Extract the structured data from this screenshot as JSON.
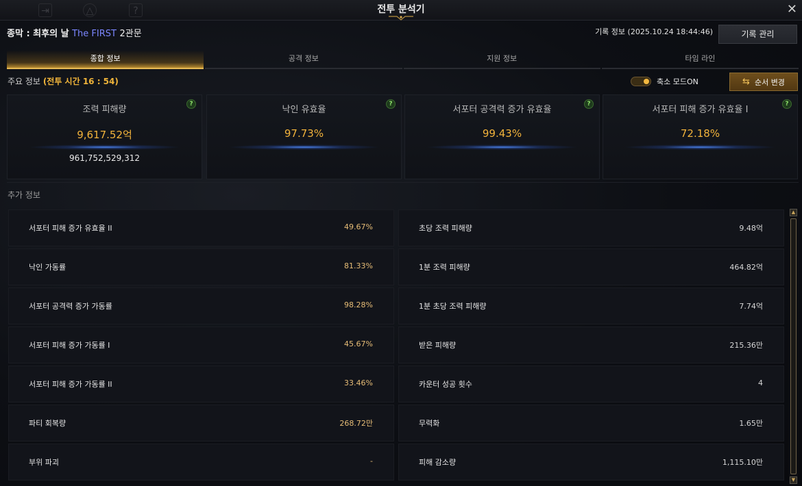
{
  "window": {
    "title": "전투 분석기",
    "close_icon": "close-icon",
    "toolbar_icons": [
      "exit-icon",
      "triangle-emblem-icon",
      "help-book-icon"
    ]
  },
  "raid": {
    "prefix": "종막 : 최후의 날",
    "highlight": "The FIRST",
    "stage": "2관문"
  },
  "record": {
    "info": "기록 정보 (2025.10.24 18:44:46)",
    "manage_label": "기록 관리"
  },
  "tabs": [
    {
      "label": "종합 정보",
      "active": true
    },
    {
      "label": "공격 정보",
      "active": false
    },
    {
      "label": "지원 정보",
      "active": false
    },
    {
      "label": "타임 라인",
      "active": false
    }
  ],
  "summary": {
    "label": "주요 정보",
    "battle_time": "(전투 시간 16 : 54)",
    "compact_mode_label": "축소 모드ON",
    "compact_mode_on": true,
    "order_button_label": "순서 변경"
  },
  "cards": [
    {
      "title": "조력 피해량",
      "value": "9,617.52억",
      "sub": "961,752,529,312"
    },
    {
      "title": "낙인 유효율",
      "value": "97.73%",
      "sub": ""
    },
    {
      "title": "서포터 공격력 증가 유효율",
      "value": "99.43%",
      "sub": ""
    },
    {
      "title": "서포터 피해 증가 유효율 I",
      "value": "72.18%",
      "sub": ""
    }
  ],
  "extra": {
    "label": "추가 정보",
    "left": [
      {
        "label": "서포터 피해 증가 유효율 II",
        "value": "49.67%"
      },
      {
        "label": "낙인 가동률",
        "value": "81.33%"
      },
      {
        "label": "서포터 공격력 증가 가동률",
        "value": "98.28%"
      },
      {
        "label": "서포터 피해 증가 가동률 I",
        "value": "45.67%"
      },
      {
        "label": "서포터 피해 증가 가동률 II",
        "value": "33.46%"
      },
      {
        "label": "파티 회복량",
        "value": "268.72만"
      },
      {
        "label": "부위 파괴",
        "value": "-"
      }
    ],
    "right": [
      {
        "label": "초당 조력 피해량",
        "value": "9.48억"
      },
      {
        "label": "1분 조력 피해량",
        "value": "464.82억"
      },
      {
        "label": "1분 초당 조력 피해량",
        "value": "7.74억"
      },
      {
        "label": "받은 피해량",
        "value": "215.36만"
      },
      {
        "label": "카운터 성공 횟수",
        "value": "4"
      },
      {
        "label": "무력화",
        "value": "1.65만"
      },
      {
        "label": "피해 감소량",
        "value": "1,115.10만"
      }
    ]
  },
  "colors": {
    "accent_gold": "#f2b33b",
    "link_blue": "#7b86ff",
    "help_green": "#8ee06a"
  }
}
